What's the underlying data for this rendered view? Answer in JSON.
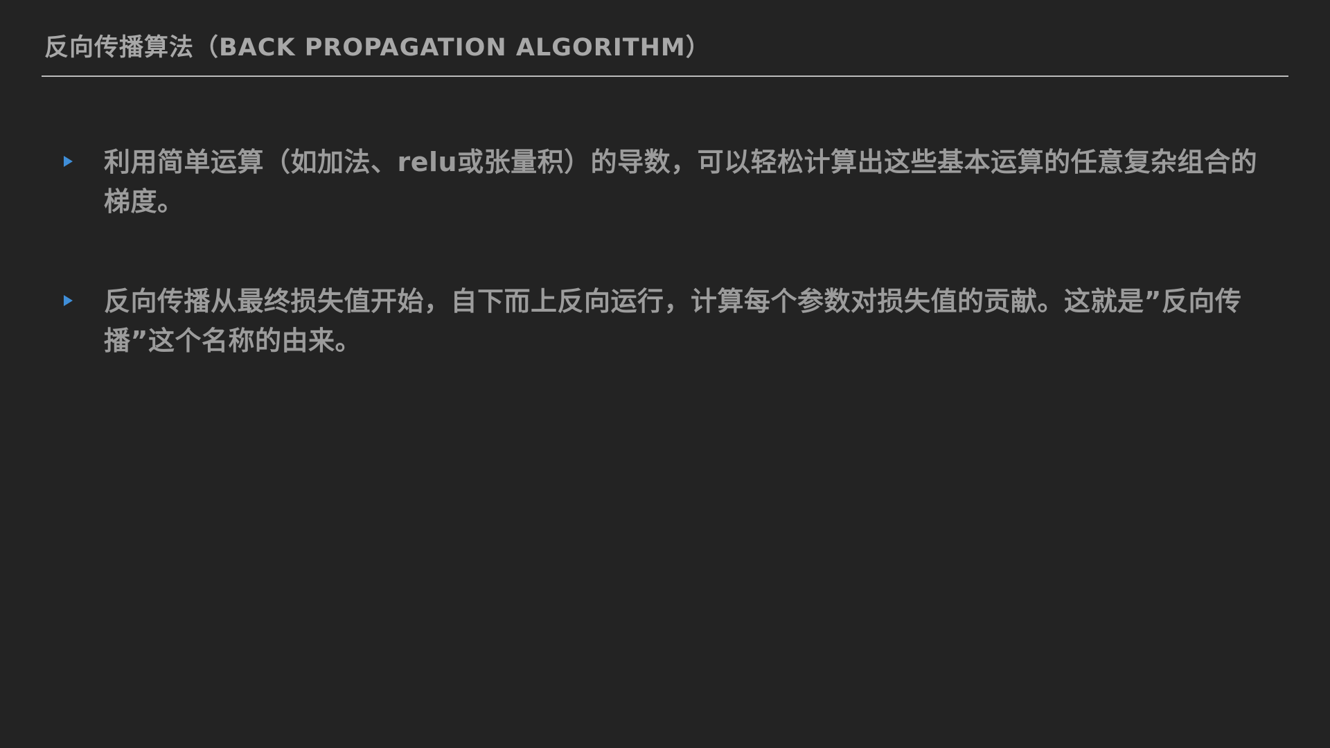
{
  "slide": {
    "title": "反向传播算法（BACK PROPAGATION ALGORITHM）",
    "bullets": [
      {
        "text": "利用简单运算（如加法、relu或张量积）的导数，可以轻松计算出这些基本运算的任意复杂组合的梯度。"
      },
      {
        "text": "反向传播从最终损失值开始，自下而上反向运行，计算每个参数对损失值的贡献。这就是”反向传播”这个名称的由来。"
      }
    ]
  },
  "colors": {
    "background": "#232323",
    "title_text": "#a8a8a8",
    "rule": "#bdbdbd",
    "body_text": "#9c9c9c",
    "bullet_marker": "#3f8ed8"
  },
  "icons": {
    "bullet_marker": "triangle-right-icon"
  }
}
